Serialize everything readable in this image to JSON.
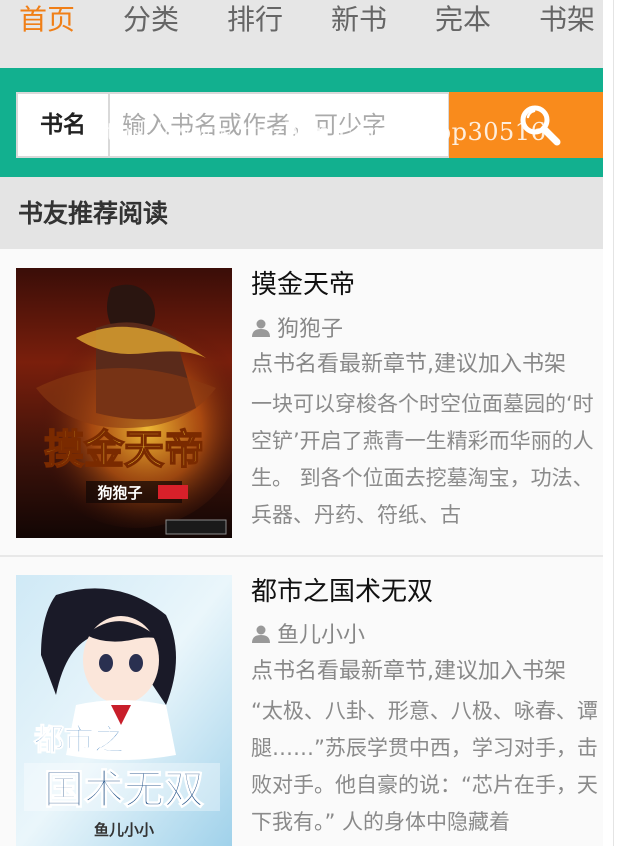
{
  "nav": {
    "items": [
      {
        "label": "首页",
        "active": true
      },
      {
        "label": "分类",
        "active": false
      },
      {
        "label": "排行",
        "active": false
      },
      {
        "label": "新书",
        "active": false
      },
      {
        "label": "完本",
        "active": false
      },
      {
        "label": "书架",
        "active": false
      }
    ]
  },
  "search": {
    "label": "书名",
    "placeholder": "输入书名或作者，可少字",
    "button_icon": "search-icon"
  },
  "watermark": "https://www.huzhan.com/ishop30516",
  "section": {
    "title": "书友推荐阅读"
  },
  "books": [
    {
      "title": "摸金天帝",
      "author": "狗狍子",
      "hint": "点书名看最新章节,建议加入书架",
      "description": "一块可以穿梭各个时空位面墓园的‘时空铲’开启了燕青一生精彩而华丽的人生。 到各个位面去挖墓淘宝，功法、兵器、丹药、符纸、古",
      "cover_title": "摸金天帝",
      "cover_author": "狗狍子"
    },
    {
      "title": "都市之国术无双",
      "author": "鱼儿小小",
      "hint": "点书名看最新章节,建议加入书架",
      "description": "“太极、八卦、形意、八极、咏春、谭腿……”苏辰学贯中西，学习对手，击败对手。他自豪的说：“芯片在手，天下我有。” 人的身体中隐藏着",
      "cover_title_1": "都市之",
      "cover_title_2": "国术无双",
      "cover_author": "鱼儿小小"
    }
  ],
  "colors": {
    "accent": "#f07f17",
    "search_band": "#12b08f",
    "search_button": "#f98b1c"
  }
}
